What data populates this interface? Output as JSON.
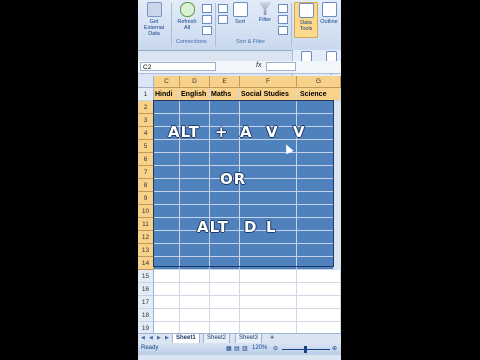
{
  "ribbon": {
    "get_external_data": "Get External Data",
    "refresh_all": "Refresh All",
    "connections_group": "Connections",
    "sort": "Sort",
    "filter": "Filter",
    "sort_filter_group": "Sort & Filter",
    "data_tools": "Data Tools",
    "outline": "Outline",
    "text_to_columns": "Text to Columns",
    "remove_duplicates": "Remo Duplic"
  },
  "formula_bar": {
    "name_box": "C2",
    "fx": "fx"
  },
  "columns": [
    "C",
    "D",
    "E",
    "F",
    "G"
  ],
  "row_numbers": [
    "1",
    "2",
    "3",
    "4",
    "5",
    "6",
    "7",
    "8",
    "9",
    "10",
    "11",
    "12",
    "13",
    "14",
    "15",
    "16",
    "17",
    "18",
    "19"
  ],
  "headers": [
    "Hindi",
    "English",
    "Maths",
    "Social Studies",
    "Science"
  ],
  "overlay": {
    "line1_a": "ALT",
    "line1_b": "+",
    "line1_c": "A",
    "line1_d": "V",
    "line1_e": "V",
    "or": "OR",
    "line2_a": "ALT",
    "line2_b": "D",
    "line2_c": "L"
  },
  "sheet_tabs": [
    "Sheet1",
    "Sheet2",
    "Sheet3"
  ],
  "status": {
    "ready": "Ready",
    "zoom": "120%"
  }
}
